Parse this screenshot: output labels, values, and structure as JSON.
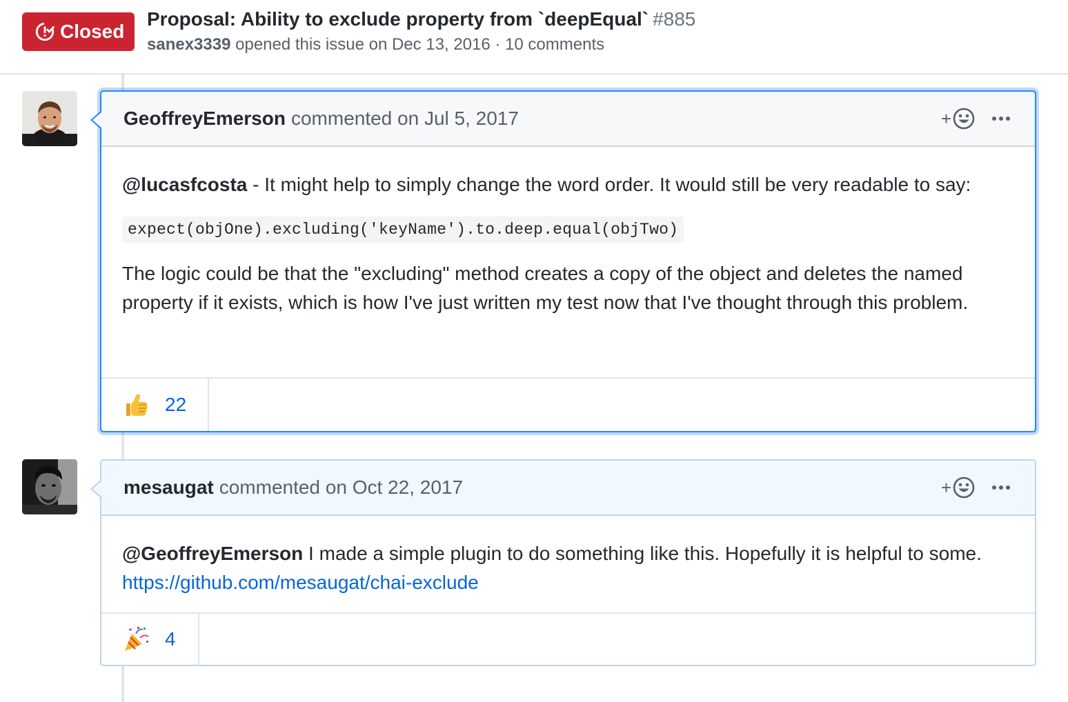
{
  "issue": {
    "state": "Closed",
    "state_color": "#cb2431",
    "title": "Proposal: Ability to exclude property from `deepEqual`",
    "number": "#885",
    "author": "sanex3339",
    "meta_text": "opened this issue on Dec 13, 2016 · 10 comments"
  },
  "comments": [
    {
      "author": "GeoffreyEmerson",
      "action": "commented on Jul 5, 2017",
      "add_reaction_label": "+",
      "body": {
        "mention": "@lucasfcosta",
        "intro": " - It might help to simply change the word order. It would still be very readable to say:",
        "code": "expect(objOne).excluding('keyName').to.deep.equal(objTwo)",
        "paragraph": "The logic could be that the \"excluding\" method creates a copy of the object and deletes the named property if it exists, which is how I've just written my test now that I've thought through this problem."
      },
      "reaction": {
        "icon": "thumbs-up-icon",
        "count": "22"
      }
    },
    {
      "author": "mesaugat",
      "action": "commented on Oct 22, 2017",
      "add_reaction_label": "+",
      "body": {
        "mention": "@GeoffreyEmerson",
        "text": " I made a simple plugin to do something like this. Hopefully it is helpful to some.",
        "link": "https://github.com/mesaugat/chai-exclude"
      },
      "reaction": {
        "icon": "tada-icon",
        "count": "4"
      }
    }
  ],
  "colors": {
    "link": "#0366d6",
    "selected_border": "#2188ff",
    "header_bg": "#f6f8fa",
    "tinted_header_bg": "#f1f8ff"
  }
}
